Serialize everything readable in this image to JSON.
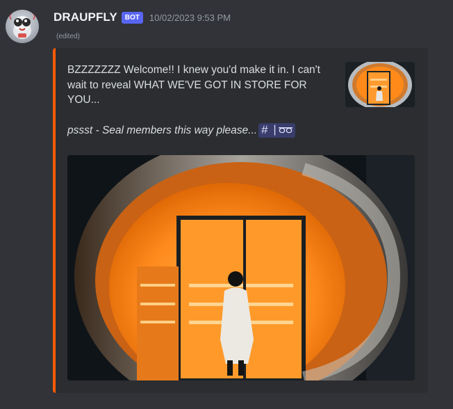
{
  "message": {
    "author": {
      "username": "DRAUPFLY",
      "bot_tag": "BOT",
      "avatar_icon": "fly-mascot-avatar"
    },
    "timestamp": "10/02/2023 9:53 PM",
    "edited_label": "(edited)",
    "embed": {
      "accent_color": "#ff5a00",
      "description_line1": "BZZZZZZZ Welcome!! I knew you'd make it in. I can't wait to reveal WHAT WE'VE GOT IN STORE FOR YOU...",
      "description_line2": "pssst - Seal members this way please...",
      "channel_mention": {
        "icon": "hash-icon",
        "separator": "|",
        "emoji": "sunglasses-icon"
      },
      "thumbnail": {
        "subject": "orange-lit-storefront-thumbnail"
      },
      "image": {
        "subject": "person-walking-into-orange-lit-store"
      }
    }
  }
}
